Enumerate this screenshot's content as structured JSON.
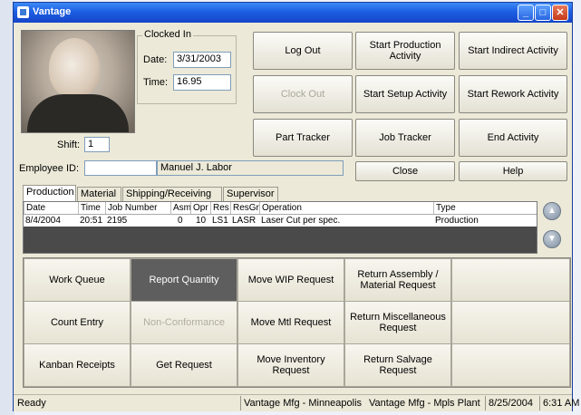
{
  "window": {
    "title": "Vantage"
  },
  "clock": {
    "group_label": "Clocked In",
    "date_label": "Date:",
    "date_value": "3/31/2003",
    "time_label": "Time:",
    "time_value": "16.95"
  },
  "shift": {
    "label": "Shift:",
    "value": "1"
  },
  "employee": {
    "id_label": "Employee ID:",
    "id_value": "",
    "name": "Manuel J. Labor"
  },
  "buttons": {
    "log_out": "Log Out",
    "clock_out": "Clock Out",
    "part_tracker": "Part Tracker",
    "start_production": "Start Production Activity",
    "start_setup": "Start Setup Activity",
    "job_tracker": "Job Tracker",
    "close": "Close",
    "start_indirect": "Start Indirect Activity",
    "start_rework": "Start Rework Activity",
    "end_activity": "End Activity",
    "help": "Help"
  },
  "tabs": [
    "Production",
    "Material",
    "Shipping/Receiving",
    "Supervisor"
  ],
  "grid": {
    "columns": [
      "Date",
      "Time",
      "Job Number",
      "Asm",
      "Opr",
      "Res",
      "ResGr",
      "Operation",
      "Type"
    ],
    "rows": [
      {
        "date": "8/4/2004",
        "time": "20:51",
        "job": "2195",
        "asm": "0",
        "opr": "10",
        "res": "LS1",
        "resgr": "LASR",
        "operation": "Laser Cut per spec.",
        "type": "Production"
      }
    ]
  },
  "tiles": {
    "work_queue": "Work Queue",
    "report_quantity": "Report Quantity",
    "move_wip": "Move WIP Request",
    "return_assembly": "Return Assembly / Material Request",
    "count_entry": "Count Entry",
    "non_conformance": "Non-Conformance",
    "move_mtl": "Move Mtl Request",
    "return_misc": "Return Miscellaneous Request",
    "kanban": "Kanban Receipts",
    "get_request": "Get Request",
    "move_inventory": "Move Inventory Request",
    "return_salvage": "Return Salvage Request"
  },
  "status": {
    "state": "Ready",
    "company": "Vantage Mfg - Minneapolis",
    "plant": "Vantage Mfg - Mpls Plant",
    "date": "8/25/2004",
    "time": "6:31 AM"
  },
  "icons": {
    "scroll_up": "arrow-up-icon",
    "scroll_down": "arrow-down-icon",
    "app": "vantage-app-icon"
  }
}
